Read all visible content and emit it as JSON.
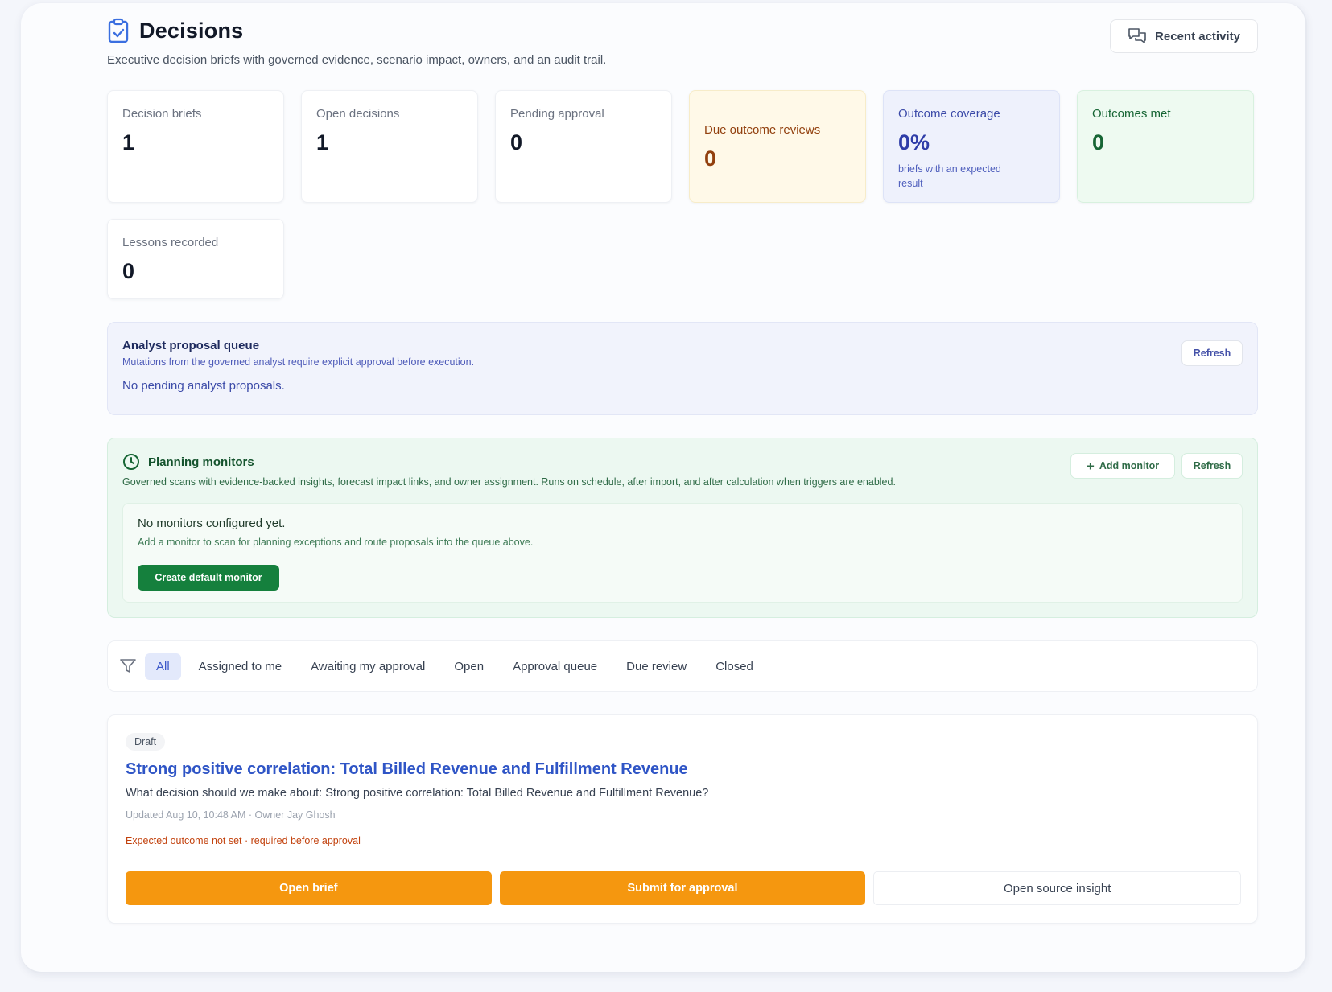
{
  "header": {
    "title": "Decisions",
    "subtitle": "Executive decision briefs with governed evidence, scenario impact, owners, and an audit trail.",
    "recent_activity": "Recent activity"
  },
  "stats": [
    {
      "label": "Decision briefs",
      "value": "1"
    },
    {
      "label": "Open decisions",
      "value": "1"
    },
    {
      "label": "Pending approval",
      "value": "0"
    },
    {
      "label": "Due outcome reviews",
      "value": "0"
    },
    {
      "label": "Outcome coverage",
      "value": "0%",
      "note": "briefs with an expected result"
    },
    {
      "label": "Outcomes met",
      "value": "0"
    },
    {
      "label": "Lessons recorded",
      "value": "0"
    }
  ],
  "analyst_queue": {
    "title": "Analyst proposal queue",
    "description": "Mutations from the governed analyst require explicit approval before execution.",
    "empty": "No pending analyst proposals.",
    "refresh": "Refresh"
  },
  "monitors": {
    "title": "Planning monitors",
    "description": "Governed scans with evidence-backed insights, forecast impact links, and owner assignment. Runs on schedule, after import, and after calculation when triggers are enabled.",
    "add_monitor": "Add monitor",
    "refresh": "Refresh",
    "empty_title": "No monitors configured yet.",
    "empty_description": "Add a monitor to scan for planning exceptions and route proposals into the queue above.",
    "create_default": "Create default monitor"
  },
  "filters": {
    "tabs": [
      "All",
      "Assigned to me",
      "Awaiting my approval",
      "Open",
      "Approval queue",
      "Due review",
      "Closed"
    ],
    "active": "All"
  },
  "decision": {
    "status": "Draft",
    "title": "Strong positive correlation: Total Billed Revenue and Fulfillment Revenue",
    "question": "What decision should we make about: Strong positive correlation: Total Billed Revenue and Fulfillment Revenue?",
    "meta": "Updated Aug 10, 10:48 AM · Owner Jay Ghosh",
    "warning": "Expected outcome not set · required before approval",
    "open_brief": "Open brief",
    "submit": "Submit for approval",
    "open_source": "Open source insight"
  },
  "colors": {
    "accent_blue": "#2f55c6",
    "primary_orange": "#f5970f",
    "success_green": "#15803d",
    "warning_text": "#c2410c"
  }
}
